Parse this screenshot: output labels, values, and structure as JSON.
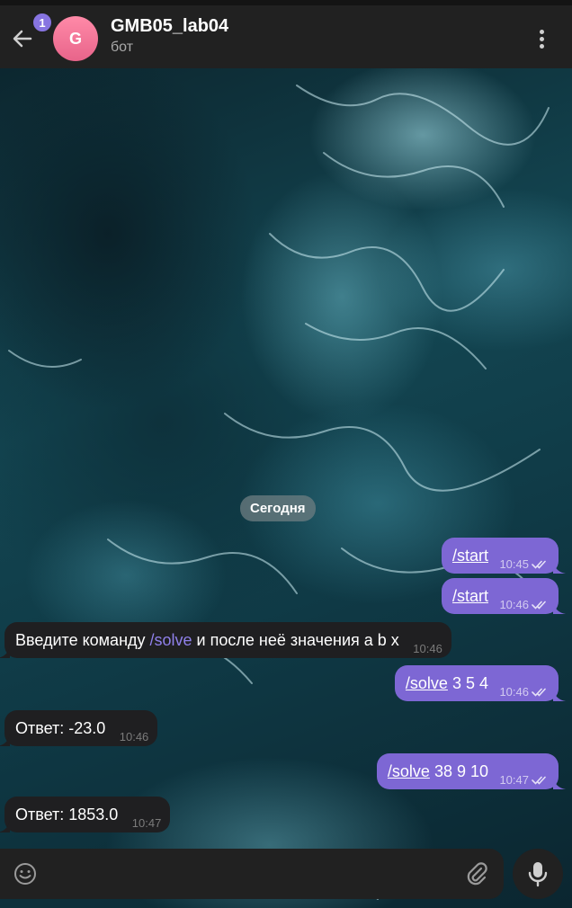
{
  "header": {
    "back_label": "Back",
    "unread_count": "1",
    "avatar_letter": "G",
    "title": "GMB05_lab04",
    "subtitle": "бот"
  },
  "chat": {
    "date_chip": "Сегодня",
    "messages": [
      {
        "direction": "out",
        "parts": [
          {
            "text": "/start",
            "style": "command"
          }
        ],
        "time": "10:45",
        "status": "read"
      },
      {
        "direction": "out",
        "parts": [
          {
            "text": "/start",
            "style": "command"
          }
        ],
        "time": "10:46",
        "status": "read"
      },
      {
        "direction": "in",
        "parts": [
          {
            "text": "Введите команду ",
            "style": "plain"
          },
          {
            "text": "/solve",
            "style": "command"
          },
          {
            "text": " и после неё значения a b x",
            "style": "plain"
          }
        ],
        "time": "10:46"
      },
      {
        "direction": "out",
        "parts": [
          {
            "text": "/solve",
            "style": "command"
          },
          {
            "text": " 3 5 4",
            "style": "plain"
          }
        ],
        "time": "10:46",
        "status": "read"
      },
      {
        "direction": "in",
        "parts": [
          {
            "text": "Ответ: -23.0",
            "style": "plain"
          }
        ],
        "time": "10:46"
      },
      {
        "direction": "out",
        "parts": [
          {
            "text": "/solve",
            "style": "command"
          },
          {
            "text": " 38 9 10",
            "style": "plain"
          }
        ],
        "time": "10:47",
        "status": "read"
      },
      {
        "direction": "in",
        "parts": [
          {
            "text": "Ответ: 1853.0",
            "style": "plain"
          }
        ],
        "time": "10:47"
      }
    ]
  },
  "composer": {
    "placeholder": "",
    "value": ""
  },
  "colors": {
    "header_bg": "#212121",
    "outgoing_bubble": "#7d67d4",
    "incoming_bubble": "#1f1f21",
    "accent": "#8774e1",
    "avatar": "#f07a9a"
  },
  "icons": [
    "arrow-left-icon",
    "more-vertical-icon",
    "double-check-icon",
    "emoji-icon",
    "paperclip-icon",
    "microphone-icon"
  ]
}
